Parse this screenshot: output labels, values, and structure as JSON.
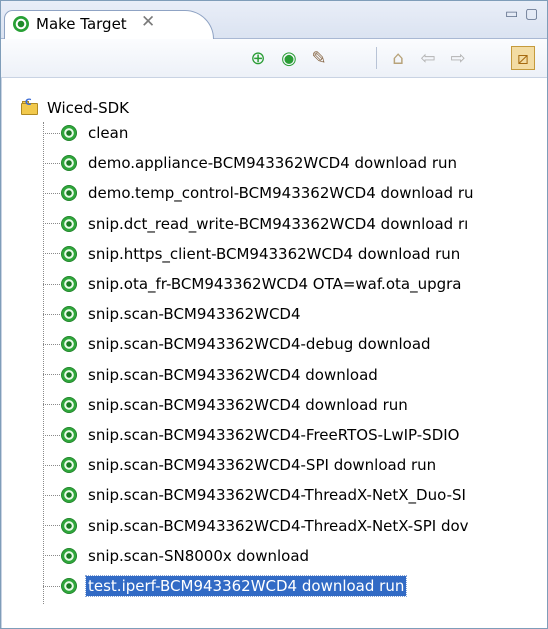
{
  "view": {
    "tab_title": "Make Target",
    "tab_close_symbol": "✕",
    "minimize_symbol": "▭",
    "maximize_symbol": "▢"
  },
  "toolbar": {
    "buttons": [
      "new-target-icon",
      "build-target-icon",
      "edit-target-icon",
      "home-icon",
      "back-icon",
      "forward-icon",
      "hide-empty-folders-icon"
    ]
  },
  "tree": {
    "root_label": "Wiced-SDK",
    "selected_index": 15,
    "items": [
      "clean",
      "demo.appliance-BCM943362WCD4 download run",
      "demo.temp_control-BCM943362WCD4 download ru",
      "snip.dct_read_write-BCM943362WCD4 download rı",
      "snip.https_client-BCM943362WCD4 download run",
      "snip.ota_fr-BCM943362WCD4 OTA=waf.ota_upgra",
      "snip.scan-BCM943362WCD4",
      "snip.scan-BCM943362WCD4-debug download",
      "snip.scan-BCM943362WCD4 download",
      "snip.scan-BCM943362WCD4 download run",
      "snip.scan-BCM943362WCD4-FreeRTOS-LwIP-SDIO",
      "snip.scan-BCM943362WCD4-SPI download run",
      "snip.scan-BCM943362WCD4-ThreadX-NetX_Duo-SI",
      "snip.scan-BCM943362WCD4-ThreadX-NetX-SPI dov",
      "snip.scan-SN8000x download",
      "test.iperf-BCM943362WCD4 download run"
    ]
  },
  "colors": {
    "selection": "#316ac5",
    "target_icon_green": "#2fa63b",
    "folder_yellow": "#f2c94c"
  }
}
